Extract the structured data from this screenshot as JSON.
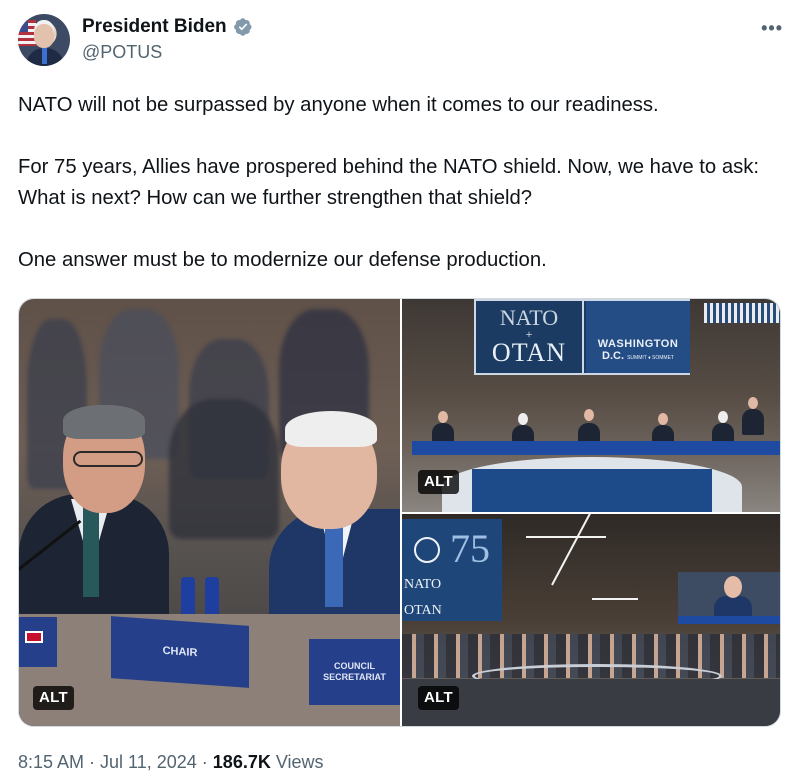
{
  "author": {
    "display_name": "President Biden",
    "handle": "@POTUS",
    "verified_icon": "verified-badge-icon",
    "verified_color": "#829aab",
    "more_label": "•••"
  },
  "tweet": {
    "paragraphs": [
      "NATO will not be surpassed by anyone when it comes to our readiness.",
      "For 75 years, Allies have prospered behind the NATO shield. Now, we have to ask: What is next? How can we further strengthen that shield?",
      "One answer must be to modernize our defense production."
    ]
  },
  "media": {
    "photos": [
      {
        "alt_label": "ALT",
        "visible_text": {
          "plate_chair": "CHAIR",
          "plate_council": "COUNCIL SECRETARIAT"
        }
      },
      {
        "alt_label": "ALT",
        "visible_text": {
          "banner_nato": "NATO",
          "banner_otan": "OTAN",
          "banner_plus": "+",
          "banner_city": "WASHINGTON",
          "banner_dc": "D.C.",
          "banner_summit": "SUMMIT ♦ SOMMET"
        }
      },
      {
        "alt_label": "ALT",
        "visible_text": {
          "screen_number": "75",
          "screen_nato": "NATO",
          "screen_otan": "OTAN"
        }
      }
    ]
  },
  "meta": {
    "time": "8:15 AM",
    "separator": "·",
    "date": "Jul 11, 2024",
    "views_count": "186.7K",
    "views_label": "Views"
  },
  "colors": {
    "text_primary": "#0f1419",
    "text_secondary": "#536471",
    "border": "#cfd9de",
    "nato_blue": "#1b3b62"
  }
}
